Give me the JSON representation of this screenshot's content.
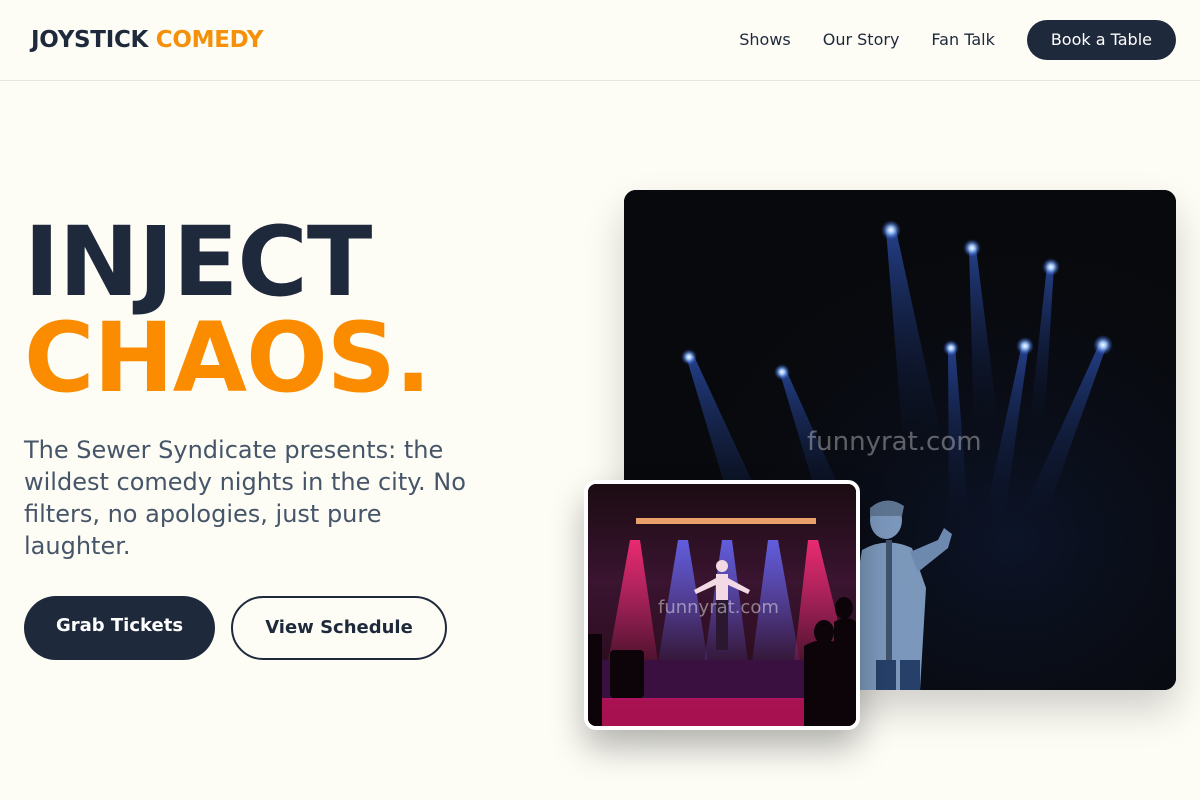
{
  "header": {
    "logo_part1": "JOYSTICK",
    "logo_part2": "COMEDY",
    "nav": [
      {
        "label": "Shows"
      },
      {
        "label": "Our Story"
      },
      {
        "label": "Fan Talk"
      }
    ],
    "cta_label": "Book a Table"
  },
  "hero": {
    "headline_line1": "INJECT",
    "headline_line2": "CHAOS.",
    "subtext": "The Sewer Syndicate presents: the wildest comedy nights in the city. No filters, no apologies, just pure laughter.",
    "primary_button": "Grab Tickets",
    "secondary_button": "View Schedule"
  },
  "images": {
    "main_watermark": "funnyrat.com",
    "inset_watermark": "funnyrat.com"
  },
  "colors": {
    "background": "#fdfcf5",
    "navy": "#1e293b",
    "accent_orange": "#fb8c00"
  }
}
